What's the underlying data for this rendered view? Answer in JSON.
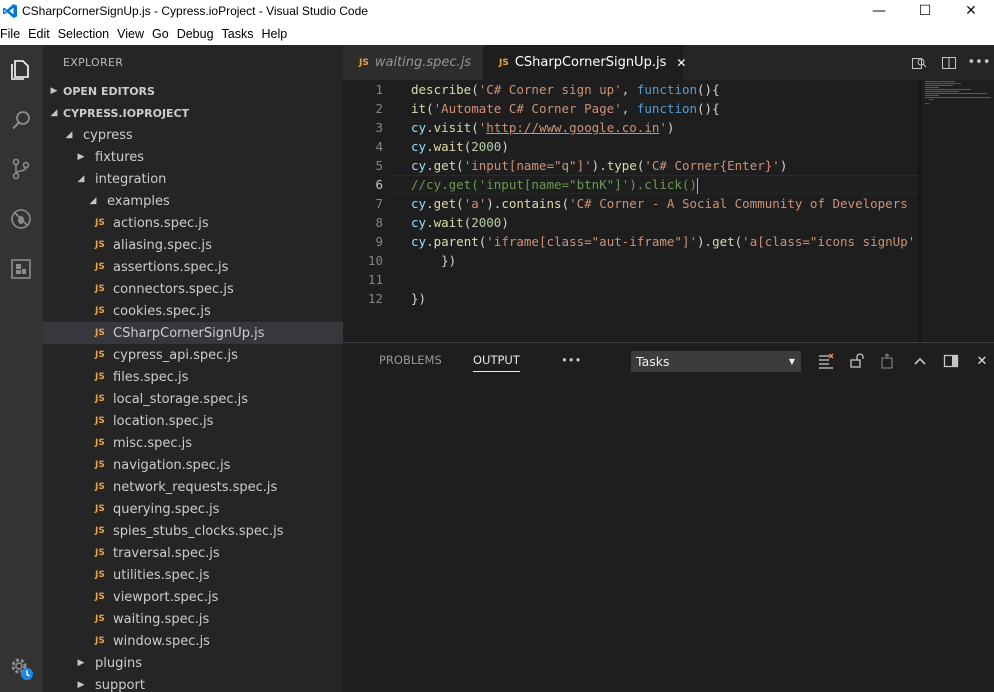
{
  "window": {
    "title": "CSharpCornerSignUp.js - Cypress.ioProject - Visual Studio Code",
    "minimize": "—",
    "maximize": "☐",
    "close": "✕"
  },
  "menu": [
    "File",
    "Edit",
    "Selection",
    "View",
    "Go",
    "Debug",
    "Tasks",
    "Help"
  ],
  "activity": [
    "explorer-icon",
    "search-icon",
    "source-control-icon",
    "debug-icon",
    "extensions-icon",
    "settings-gear-icon"
  ],
  "sidebar": {
    "title": "EXPLORER",
    "open_editors": "OPEN EDITORS",
    "project": "CYPRESS.IOPROJECT",
    "tree": [
      {
        "label": "cypress",
        "kind": "folder",
        "open": true
      },
      {
        "label": "fixtures",
        "kind": "folder",
        "open": false
      },
      {
        "label": "integration",
        "kind": "folder",
        "open": true
      },
      {
        "label": "examples",
        "kind": "folder",
        "open": true
      },
      {
        "label": "actions.spec.js",
        "kind": "js"
      },
      {
        "label": "aliasing.spec.js",
        "kind": "js"
      },
      {
        "label": "assertions.spec.js",
        "kind": "js"
      },
      {
        "label": "connectors.spec.js",
        "kind": "js"
      },
      {
        "label": "cookies.spec.js",
        "kind": "js"
      },
      {
        "label": "CSharpCornerSignUp.js",
        "kind": "js",
        "selected": true
      },
      {
        "label": "cypress_api.spec.js",
        "kind": "js"
      },
      {
        "label": "files.spec.js",
        "kind": "js"
      },
      {
        "label": "local_storage.spec.js",
        "kind": "js"
      },
      {
        "label": "location.spec.js",
        "kind": "js"
      },
      {
        "label": "misc.spec.js",
        "kind": "js"
      },
      {
        "label": "navigation.spec.js",
        "kind": "js"
      },
      {
        "label": "network_requests.spec.js",
        "kind": "js"
      },
      {
        "label": "querying.spec.js",
        "kind": "js"
      },
      {
        "label": "spies_stubs_clocks.spec.js",
        "kind": "js"
      },
      {
        "label": "traversal.spec.js",
        "kind": "js"
      },
      {
        "label": "utilities.spec.js",
        "kind": "js"
      },
      {
        "label": "viewport.spec.js",
        "kind": "js"
      },
      {
        "label": "waiting.spec.js",
        "kind": "js"
      },
      {
        "label": "window.spec.js",
        "kind": "js"
      },
      {
        "label": "plugins",
        "kind": "folder",
        "open": false
      },
      {
        "label": "support",
        "kind": "folder",
        "open": false
      }
    ],
    "js_badge": "JS"
  },
  "tabs": [
    {
      "label": "waiting.spec.js",
      "active": false
    },
    {
      "label": "CSharpCornerSignUp.js",
      "active": true,
      "close": "✕"
    }
  ],
  "editor": {
    "current_line": 6,
    "lines": [
      {
        "n": "1",
        "tokens": [
          [
            "fn",
            "describe"
          ],
          [
            "punc",
            "("
          ],
          [
            "str",
            "'C# Corner sign up'"
          ],
          [
            "punc",
            ", "
          ],
          [
            "kw",
            "function"
          ],
          [
            "punc",
            "(){"
          ]
        ]
      },
      {
        "n": "2",
        "tokens": [
          [
            "fn",
            "it"
          ],
          [
            "punc",
            "("
          ],
          [
            "str",
            "'Automate C# Corner Page'"
          ],
          [
            "punc",
            ", "
          ],
          [
            "kw",
            "function"
          ],
          [
            "punc",
            "(){"
          ]
        ]
      },
      {
        "n": "3",
        "tokens": [
          [
            "id",
            "cy"
          ],
          [
            "punc",
            "."
          ],
          [
            "fn",
            "visit"
          ],
          [
            "punc",
            "("
          ],
          [
            "str",
            "'"
          ],
          [
            "url",
            "http://www.google.co.in"
          ],
          [
            "str",
            "'"
          ],
          [
            "punc",
            ")"
          ]
        ]
      },
      {
        "n": "4",
        "tokens": [
          [
            "id",
            "cy"
          ],
          [
            "punc",
            "."
          ],
          [
            "fn",
            "wait"
          ],
          [
            "punc",
            "("
          ],
          [
            "num",
            "2000"
          ],
          [
            "punc",
            ")"
          ]
        ]
      },
      {
        "n": "5",
        "tokens": [
          [
            "id",
            "cy"
          ],
          [
            "punc",
            "."
          ],
          [
            "fn",
            "get"
          ],
          [
            "punc",
            "("
          ],
          [
            "str",
            "'input[name=\"q\"]'"
          ],
          [
            "punc",
            ")."
          ],
          [
            "fn",
            "type"
          ],
          [
            "punc",
            "("
          ],
          [
            "str",
            "'C# Corner{Enter}'"
          ],
          [
            "punc",
            ")"
          ]
        ]
      },
      {
        "n": "6",
        "tokens": [
          [
            "cmt",
            "//cy.get('input[name=\"btnK\"]').click()"
          ]
        ],
        "cursor": true
      },
      {
        "n": "7",
        "tokens": [
          [
            "id",
            "cy"
          ],
          [
            "punc",
            "."
          ],
          [
            "fn",
            "get"
          ],
          [
            "punc",
            "("
          ],
          [
            "str",
            "'a'"
          ],
          [
            "punc",
            ")."
          ],
          [
            "fn",
            "contains"
          ],
          [
            "punc",
            "("
          ],
          [
            "str",
            "'C# Corner - A Social Community of Developers"
          ]
        ]
      },
      {
        "n": "8",
        "tokens": [
          [
            "id",
            "cy"
          ],
          [
            "punc",
            "."
          ],
          [
            "fn",
            "wait"
          ],
          [
            "punc",
            "("
          ],
          [
            "num",
            "2000"
          ],
          [
            "punc",
            ")"
          ]
        ]
      },
      {
        "n": "9",
        "tokens": [
          [
            "id",
            "cy"
          ],
          [
            "punc",
            "."
          ],
          [
            "fn",
            "parent"
          ],
          [
            "punc",
            "("
          ],
          [
            "str",
            "'iframe[class=\"aut-iframe\"]'"
          ],
          [
            "punc",
            ")."
          ],
          [
            "fn",
            "get"
          ],
          [
            "punc",
            "("
          ],
          [
            "str",
            "'a[class=\"icons signUp'"
          ]
        ]
      },
      {
        "n": "10",
        "tokens": [
          [
            "punc",
            "    })"
          ]
        ]
      },
      {
        "n": "11",
        "tokens": []
      },
      {
        "n": "12",
        "tokens": [
          [
            "punc",
            "})"
          ]
        ]
      }
    ]
  },
  "panel": {
    "tabs": [
      "PROBLEMS",
      "OUTPUT"
    ],
    "active_tab": "OUTPUT",
    "more": "•••",
    "task_select": "Tasks"
  }
}
